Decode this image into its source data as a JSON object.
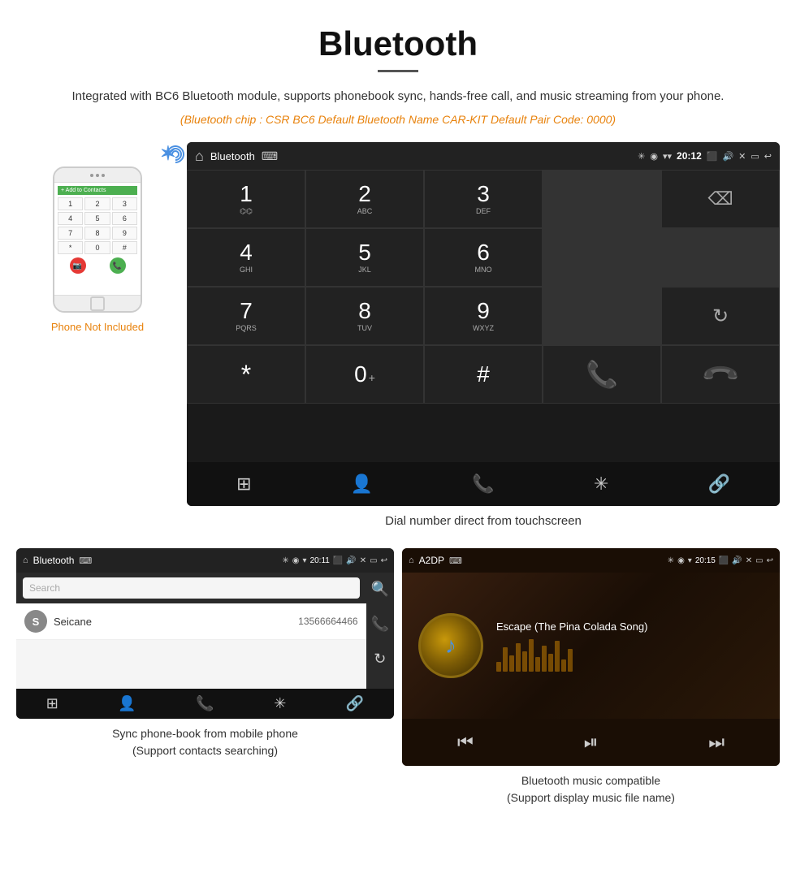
{
  "header": {
    "title": "Bluetooth",
    "description": "Integrated with BC6 Bluetooth module, supports phonebook sync, hands-free call, and music streaming from your phone.",
    "specs": "(Bluetooth chip : CSR BC6    Default Bluetooth Name CAR-KIT    Default Pair Code: 0000)"
  },
  "dial_screen": {
    "status_bar": {
      "title": "Bluetooth",
      "usb_icon": "⌨",
      "time": "20:12",
      "bt_icon": "✳",
      "location_icon": "◉",
      "wifi_icon": "▼",
      "camera_icon": "📷",
      "volume_icon": "🔊",
      "x_icon": "✕",
      "monitor_icon": "▭",
      "back_icon": "↩"
    },
    "keys": [
      {
        "main": "1",
        "sub": "⌬⌬"
      },
      {
        "main": "2",
        "sub": "ABC"
      },
      {
        "main": "3",
        "sub": "DEF"
      },
      {
        "main": "",
        "sub": ""
      },
      {
        "main": "⌫",
        "sub": ""
      },
      {
        "main": "4",
        "sub": "GHI"
      },
      {
        "main": "5",
        "sub": "JKL"
      },
      {
        "main": "6",
        "sub": "MNO"
      },
      {
        "main": "",
        "sub": ""
      },
      {
        "main": "",
        "sub": ""
      },
      {
        "main": "7",
        "sub": "PQRS"
      },
      {
        "main": "8",
        "sub": "TUV"
      },
      {
        "main": "9",
        "sub": "WXYZ"
      },
      {
        "main": "",
        "sub": ""
      },
      {
        "main": "↻",
        "sub": ""
      },
      {
        "main": "*",
        "sub": ""
      },
      {
        "main": "0",
        "sub": "+"
      },
      {
        "main": "#",
        "sub": ""
      },
      {
        "main": "📞",
        "sub": ""
      },
      {
        "main": "📵",
        "sub": ""
      }
    ],
    "bottom_icons": [
      "⊞",
      "👤",
      "📞",
      "✳",
      "🔗"
    ]
  },
  "dial_caption": "Dial number direct from touchscreen",
  "phonebook_screen": {
    "status_bar": {
      "title": "Bluetooth",
      "time": "20:11"
    },
    "search_placeholder": "Search",
    "contact": {
      "initial": "S",
      "name": "Seicane",
      "number": "13566664466"
    },
    "bottom_icons": [
      "⊞",
      "👤",
      "📞",
      "✳",
      "🔗"
    ]
  },
  "phonebook_caption": "Sync phone-book from mobile phone\n(Support contacts searching)",
  "music_screen": {
    "status_bar": {
      "title": "A2DP",
      "time": "20:15"
    },
    "song_title": "Escape (The Pina Colada Song)",
    "controls": [
      "⏮",
      "⏯",
      "⏭"
    ]
  },
  "music_caption": "Bluetooth music compatible\n(Support display music file name)",
  "phone_not_included": "Phone Not Included",
  "eq_bars": [
    12,
    30,
    20,
    35,
    25,
    40,
    18,
    32,
    22,
    38,
    15,
    28
  ]
}
